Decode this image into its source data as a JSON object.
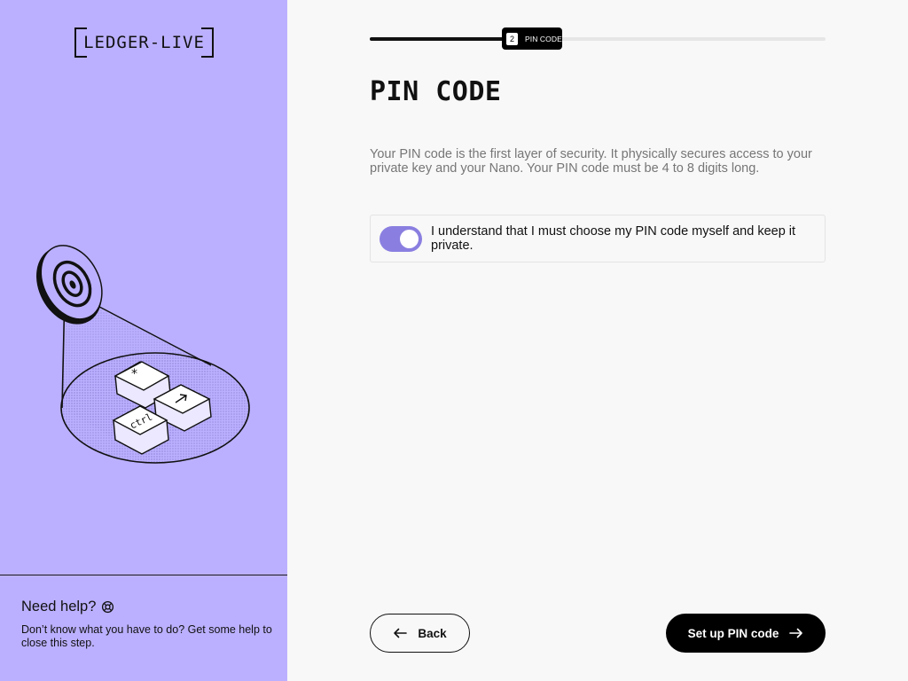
{
  "brand": {
    "logo_text": "LEDGER-LIVE"
  },
  "stepper": {
    "current_step_number": "2",
    "current_step_label": "PIN CODE",
    "progress": 0.3
  },
  "main": {
    "title": "PIN CODE",
    "description": "Your PIN code is the first layer of security. It physically secures access to your private key and your Nano. Your PIN code must be 4 to 8 digits long.",
    "consent": {
      "label": "I understand that I must choose my PIN code myself and keep it private.",
      "checked": true
    }
  },
  "help": {
    "title": "Need help?",
    "text": "Don’t know what you have to do? Get some help to close this step.",
    "icon": "lifebuoy-icon"
  },
  "footer": {
    "back_label": "Back",
    "next_label": "Set up PIN code",
    "back_icon": "arrow-left-icon",
    "next_icon": "arrow-right-icon"
  },
  "colors": {
    "sidebar_bg": "#bbb0ff",
    "toggle_on": "#8a7fe0",
    "primary_button": "#000000"
  }
}
